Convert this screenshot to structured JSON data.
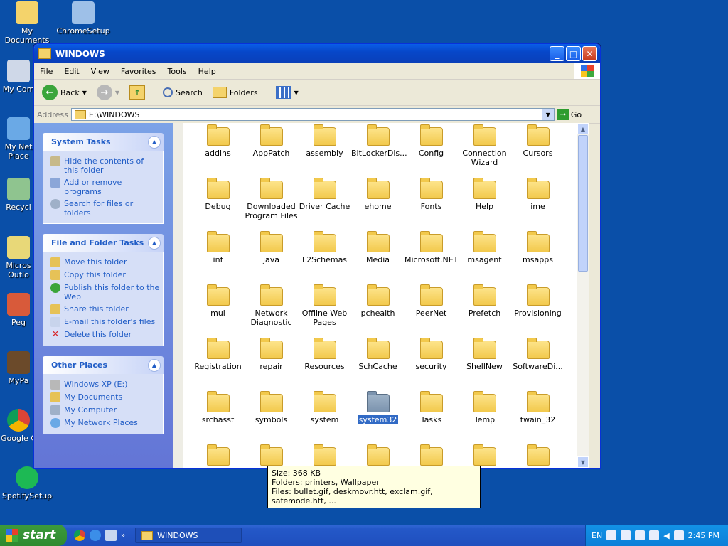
{
  "desktop": {
    "icons": [
      {
        "label": "My Documents"
      },
      {
        "label": "ChromeSetup"
      },
      {
        "label": "My Com"
      },
      {
        "label": "My Net\nPlace"
      },
      {
        "label": "Recycl"
      },
      {
        "label": "Micros\nOutlo"
      },
      {
        "label": "Peg"
      },
      {
        "label": "MyPa"
      },
      {
        "label": "Google C"
      },
      {
        "label": "SpotifySetup"
      }
    ]
  },
  "window": {
    "title": "WINDOWS",
    "menu": [
      "File",
      "Edit",
      "View",
      "Favorites",
      "Tools",
      "Help"
    ],
    "toolbar": {
      "back": "Back",
      "search": "Search",
      "folders": "Folders"
    },
    "address": {
      "label": "Address",
      "value": "E:\\WINDOWS",
      "go": "Go"
    }
  },
  "taskpane": {
    "system_tasks": {
      "title": "System Tasks",
      "items": [
        "Hide the contents of this folder",
        "Add or remove programs",
        "Search for files or folders"
      ]
    },
    "file_tasks": {
      "title": "File and Folder Tasks",
      "items": [
        "Move this folder",
        "Copy this folder",
        "Publish this folder to the Web",
        "Share this folder",
        "E-mail this folder's files",
        "Delete this folder"
      ]
    },
    "other_places": {
      "title": "Other Places",
      "items": [
        "Windows XP (E:)",
        "My Documents",
        "My Computer",
        "My Network Places"
      ]
    }
  },
  "files": [
    {
      "name": "addins"
    },
    {
      "name": "AppPatch"
    },
    {
      "name": "assembly"
    },
    {
      "name": "BitLockerDis..."
    },
    {
      "name": "Config"
    },
    {
      "name": "Connection Wizard"
    },
    {
      "name": "Cursors"
    },
    {
      "name": "Debug"
    },
    {
      "name": "Downloaded Program Files"
    },
    {
      "name": "Driver Cache"
    },
    {
      "name": "ehome"
    },
    {
      "name": "Fonts"
    },
    {
      "name": "Help"
    },
    {
      "name": "ime"
    },
    {
      "name": "inf"
    },
    {
      "name": "java"
    },
    {
      "name": "L2Schemas"
    },
    {
      "name": "Media"
    },
    {
      "name": "Microsoft.NET"
    },
    {
      "name": "msagent"
    },
    {
      "name": "msapps"
    },
    {
      "name": "mui"
    },
    {
      "name": "Network Diagnostic"
    },
    {
      "name": "Offline Web Pages"
    },
    {
      "name": "pchealth"
    },
    {
      "name": "PeerNet"
    },
    {
      "name": "Prefetch"
    },
    {
      "name": "Provisioning"
    },
    {
      "name": "Registration"
    },
    {
      "name": "repair"
    },
    {
      "name": "Resources"
    },
    {
      "name": "SchCache"
    },
    {
      "name": "security"
    },
    {
      "name": "ShellNew"
    },
    {
      "name": "SoftwareDi..."
    },
    {
      "name": "srchasst"
    },
    {
      "name": "symbols"
    },
    {
      "name": "system"
    },
    {
      "name": "system32",
      "selected": true
    },
    {
      "name": "Tasks"
    },
    {
      "name": "Temp"
    },
    {
      "name": "twain_32"
    },
    {
      "name": ""
    },
    {
      "name": ""
    },
    {
      "name": ""
    },
    {
      "name": ""
    },
    {
      "name": ""
    },
    {
      "name": ""
    },
    {
      "name": ""
    }
  ],
  "tooltip": {
    "size": "Size: 368 KB",
    "folders": "Folders: printers, Wallpaper",
    "files": "Files: bullet.gif, deskmovr.htt, exclam.gif, safemode.htt, ..."
  },
  "taskbar": {
    "start": "start",
    "task": "WINDOWS",
    "lang": "EN",
    "clock": "2:45 PM"
  }
}
